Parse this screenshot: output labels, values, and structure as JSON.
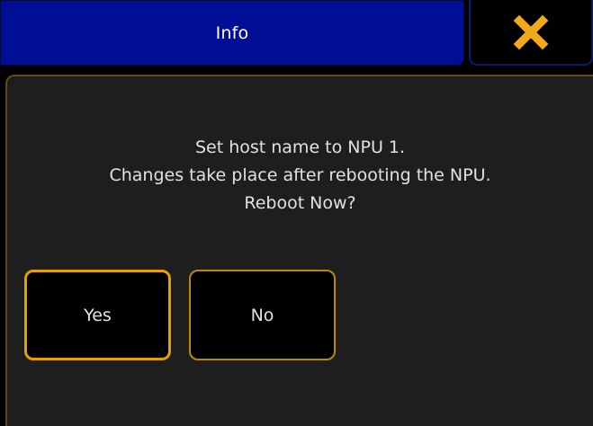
{
  "dialog": {
    "title": "Info",
    "close_icon": "close-x-icon",
    "message_lines": [
      "Set host name to NPU 1.",
      "Changes take place after rebooting the NPU.",
      "Reboot Now?"
    ],
    "buttons": {
      "yes_label": "Yes",
      "no_label": "No"
    }
  },
  "colors": {
    "title_bar": "#000e96",
    "panel_background": "#1e1e1e",
    "accent_focus": "#e8a000",
    "close_icon": "#f3a81b",
    "text": "#e2e2e2"
  }
}
